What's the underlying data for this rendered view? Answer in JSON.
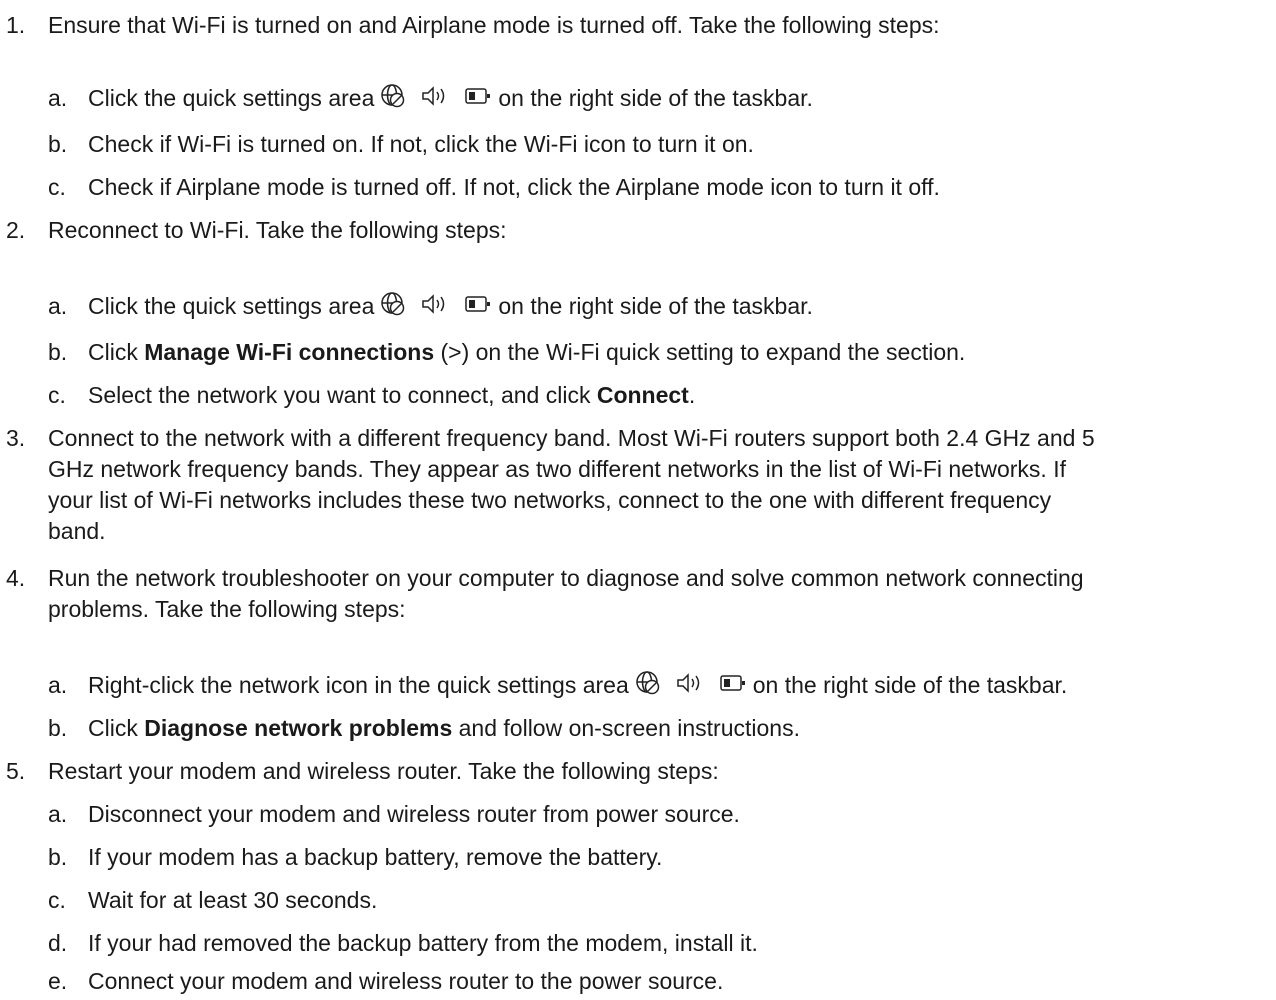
{
  "steps": [
    {
      "num": "1.",
      "text": "Ensure that Wi-Fi is turned on and Airplane mode is turned off. Take the following steps:",
      "substeps": [
        {
          "letter": "a.",
          "pre": "Click the quick settings area",
          "post": "on the right side of the taskbar."
        },
        {
          "letter": "b.",
          "text": "Check if Wi-Fi is turned on. If not, click the Wi-Fi icon to turn it on."
        },
        {
          "letter": "c.",
          "text": "Check if Airplane mode is turned off. If not, click the Airplane mode icon to turn it off."
        }
      ]
    },
    {
      "num": "2.",
      "text": "Reconnect to Wi-Fi. Take the following steps:",
      "substeps": [
        {
          "letter": "a.",
          "pre": "Click the quick settings area",
          "post": "on the right side of the taskbar."
        },
        {
          "letter": "b.",
          "pre": "Click",
          "bold": "Manage Wi-Fi connections",
          "post": "(>) on the Wi-Fi quick setting to expand the section."
        },
        {
          "letter": "c.",
          "pre": "Select the network you want to connect, and click",
          "bold": "Connect",
          "post": "."
        }
      ]
    },
    {
      "num": "3.",
      "lines": [
        "Connect to the network with a different frequency band. Most Wi-Fi routers support both 2.4 GHz and 5",
        "GHz network frequency bands. They appear as two different networks in the list of Wi-Fi networks. If",
        "your list of Wi-Fi networks includes these two networks, connect to the one with different frequency",
        "band."
      ]
    },
    {
      "num": "4.",
      "lines": [
        "Run the network troubleshooter on your computer to diagnose and solve common network connecting",
        "problems. Take the following steps:"
      ],
      "substeps": [
        {
          "letter": "a.",
          "pre": "Right-click the network icon in the quick settings area",
          "post": "on the right side of the taskbar."
        },
        {
          "letter": "b.",
          "pre": "Click",
          "bold": "Diagnose network problems",
          "post": "and follow on-screen instructions."
        }
      ]
    },
    {
      "num": "5.",
      "text": "Restart your modem and wireless router. Take the following steps:",
      "substeps": [
        {
          "letter": "a.",
          "text": "Disconnect your modem and wireless router from power source."
        },
        {
          "letter": "b.",
          "text": "If your modem has a backup battery, remove the battery."
        },
        {
          "letter": "c.",
          "text": "Wait for at least 30 seconds."
        },
        {
          "letter": "d.",
          "text": "If your had removed the backup battery from the modem, install it."
        },
        {
          "letter": "e.",
          "text": "Connect your modem and wireless router to the power source."
        }
      ]
    }
  ],
  "icons": [
    "network-globe-icon",
    "speaker-icon",
    "battery-icon"
  ]
}
